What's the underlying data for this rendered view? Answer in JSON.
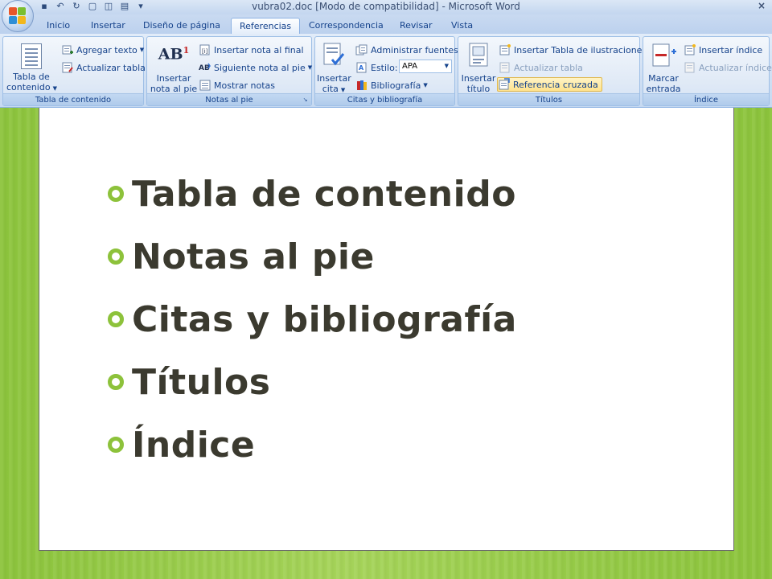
{
  "window": {
    "title": "vubra02.doc [Modo de compatibilidad] - Microsoft Word"
  },
  "tabs": [
    {
      "label": "Inicio"
    },
    {
      "label": "Insertar"
    },
    {
      "label": "Diseño de página"
    },
    {
      "label": "Referencias",
      "active": true
    },
    {
      "label": "Correspondencia"
    },
    {
      "label": "Revisar"
    },
    {
      "label": "Vista"
    }
  ],
  "ribbon": {
    "toc_group": {
      "label": "Tabla de contenido",
      "big_line1": "Tabla de",
      "big_line2": "contenido",
      "add_text": "Agregar texto",
      "update_table": "Actualizar tabla"
    },
    "footnotes_group": {
      "label": "Notas al pie",
      "big_line1": "Insertar",
      "big_line2": "nota al pie",
      "insert_endnote": "Insertar nota al final",
      "next_footnote": "Siguiente nota al pie",
      "show_notes": "Mostrar notas",
      "icon_text": "AB"
    },
    "citations_group": {
      "label": "Citas y bibliografía",
      "big_line1": "Insertar",
      "big_line2": "cita",
      "manage_sources": "Administrar fuentes",
      "style_label": "Estilo:",
      "style_value": "APA",
      "bibliography": "Bibliografía"
    },
    "captions_group": {
      "label": "Títulos",
      "big_line1": "Insertar",
      "big_line2": "título",
      "insert_table_figures": "Insertar Tabla de ilustraciones",
      "update_table": "Actualizar tabla",
      "cross_reference": "Referencia cruzada"
    },
    "index_group": {
      "label": "Índice",
      "big_line1": "Marcar",
      "big_line2": "entrada",
      "insert_index": "Insertar índice",
      "update_index": "Actualizar índice"
    }
  },
  "slide": {
    "items": [
      "Tabla de contenido",
      "Notas al pie",
      "Citas y bibliografía",
      "Títulos",
      "Índice"
    ]
  },
  "colors": {
    "bullet": "#8dc23b",
    "text": "#3b3a2f",
    "background": "#98cc4a"
  }
}
